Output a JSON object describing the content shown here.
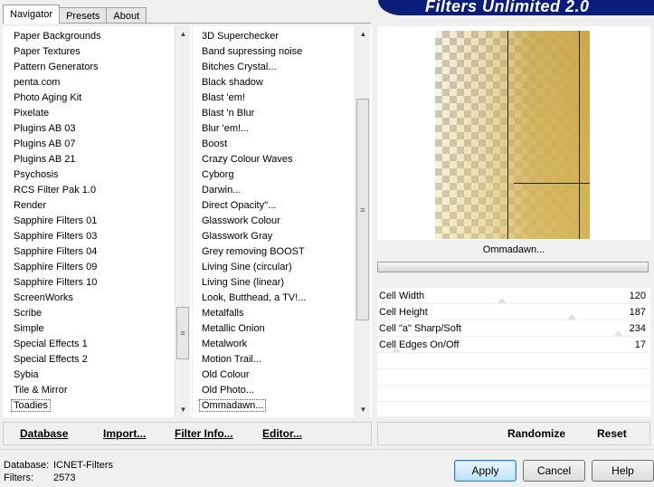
{
  "tabs": [
    {
      "label": "Navigator",
      "active": true
    },
    {
      "label": "Presets",
      "active": false
    },
    {
      "label": "About",
      "active": false
    }
  ],
  "banner": {
    "title": "Filters Unlimited 2.0"
  },
  "categories": {
    "items": [
      "Paper Backgrounds",
      "Paper Textures",
      "Pattern Generators",
      "penta.com",
      "Photo Aging Kit",
      "Pixelate",
      "Plugins AB 03",
      "Plugins AB 07",
      "Plugins AB 21",
      "Psychosis",
      "RCS Filter Pak 1.0",
      "Render",
      "Sapphire Filters 01",
      "Sapphire Filters 03",
      "Sapphire Filters 04",
      "Sapphire Filters 09",
      "Sapphire Filters 10",
      "ScreenWorks",
      "Scribe",
      "Simple",
      "Special Effects 1",
      "Special Effects 2",
      "Sybia",
      "Tile & Mirror",
      "Toadies"
    ],
    "selected": "Toadies"
  },
  "filters": {
    "items": [
      "3D Superchecker",
      "Band supressing noise",
      "Bitches Crystal...",
      "Black shadow",
      "Blast 'em!",
      "Blast 'n Blur",
      "Blur 'em!...",
      "Boost",
      "Crazy Colour Waves",
      "Cyborg",
      "Darwin...",
      "Direct Opacity''...",
      "Glasswork Colour",
      "Glasswork Gray",
      "Grey removing BOOST",
      "Living Sine (circular)",
      "Living Sine (linear)",
      "Look, Butthead, a TV!...",
      "Metalfalls",
      "Metallic Onion",
      "Metalwork",
      "Motion Trail...",
      "Old Colour",
      "Old Photo...",
      "Ommadawn..."
    ],
    "selected": "Ommadawn..."
  },
  "preview": {
    "filter_name": "Ommadawn..."
  },
  "params": [
    {
      "label": "Cell Width",
      "value": "120"
    },
    {
      "label": "Cell Height",
      "value": "187"
    },
    {
      "label": "Cell \"a\" Sharp/Soft",
      "value": "234"
    },
    {
      "label": "Cell Edges On/Off",
      "value": "17"
    }
  ],
  "toolbar_left": {
    "database": "Database",
    "import": "Import...",
    "filter_info": "Filter Info...",
    "editor": "Editor..."
  },
  "toolbar_right": {
    "randomize": "Randomize",
    "reset": "Reset"
  },
  "status": {
    "database_label": "Database:",
    "database_value": "ICNET-Filters",
    "filters_label": "Filters:",
    "filters_value": "2573"
  },
  "buttons": {
    "apply": "Apply",
    "cancel": "Cancel",
    "help": "Help"
  }
}
